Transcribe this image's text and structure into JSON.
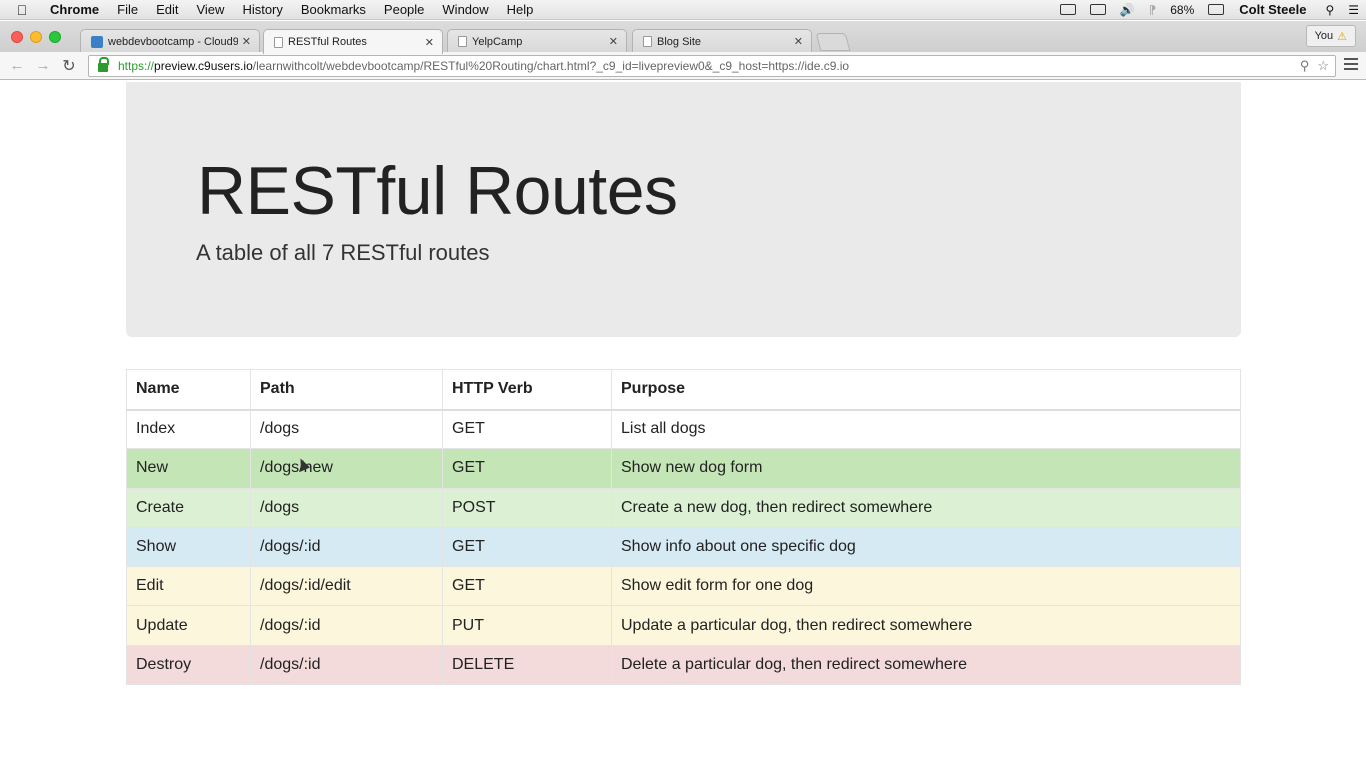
{
  "menubar": {
    "app_name": "Chrome",
    "items": [
      "File",
      "Edit",
      "View",
      "History",
      "Bookmarks",
      "People",
      "Window",
      "Help"
    ],
    "battery": "68%",
    "user": "Colt Steele"
  },
  "tabs": [
    {
      "title": "webdevbootcamp - Cloud9",
      "favicon": "cloud9-icon",
      "active": false
    },
    {
      "title": "RESTful Routes",
      "favicon": "page-icon",
      "active": true
    },
    {
      "title": "YelpCamp",
      "favicon": "page-icon",
      "active": false
    },
    {
      "title": "Blog Site",
      "favicon": "page-icon",
      "active": false
    }
  ],
  "profile": {
    "label": "You"
  },
  "address_bar": {
    "scheme": "https://",
    "host": "preview.c9users.io",
    "rest": "/learnwithcolt/webdevbootcamp/RESTful%20Routing/chart.html?_c9_id=livepreview0&_c9_host=https://ide.c9.io"
  },
  "page": {
    "title": "RESTful Routes",
    "subtitle": "A table of all 7 RESTful routes"
  },
  "table": {
    "headers": [
      "Name",
      "Path",
      "HTTP Verb",
      "Purpose"
    ],
    "rows": [
      {
        "name": "Index",
        "path": "/dogs",
        "verb": "GET",
        "purpose": "List all dogs",
        "color": "#ffffff"
      },
      {
        "name": "New",
        "path": "/dogs/new",
        "verb": "GET",
        "purpose": "Show new dog form",
        "color": "#c4e6b6"
      },
      {
        "name": "Create",
        "path": "/dogs",
        "verb": "POST",
        "purpose": "Create a new dog, then redirect somewhere",
        "color": "#dcf0d4"
      },
      {
        "name": "Show",
        "path": "/dogs/:id",
        "verb": "GET",
        "purpose": "Show info about one specific dog",
        "color": "#d6eaf3"
      },
      {
        "name": "Edit",
        "path": "/dogs/:id/edit",
        "verb": "GET",
        "purpose": "Show edit form for one dog",
        "color": "#fbf6dc"
      },
      {
        "name": "Update",
        "path": "/dogs/:id",
        "verb": "PUT",
        "purpose": "Update a particular dog, then redirect somewhere",
        "color": "#fbf6dc"
      },
      {
        "name": "Destroy",
        "path": "/dogs/:id",
        "verb": "DELETE",
        "purpose": "Delete a particular dog, then redirect somewhere",
        "color": "#f3dadb"
      }
    ]
  }
}
